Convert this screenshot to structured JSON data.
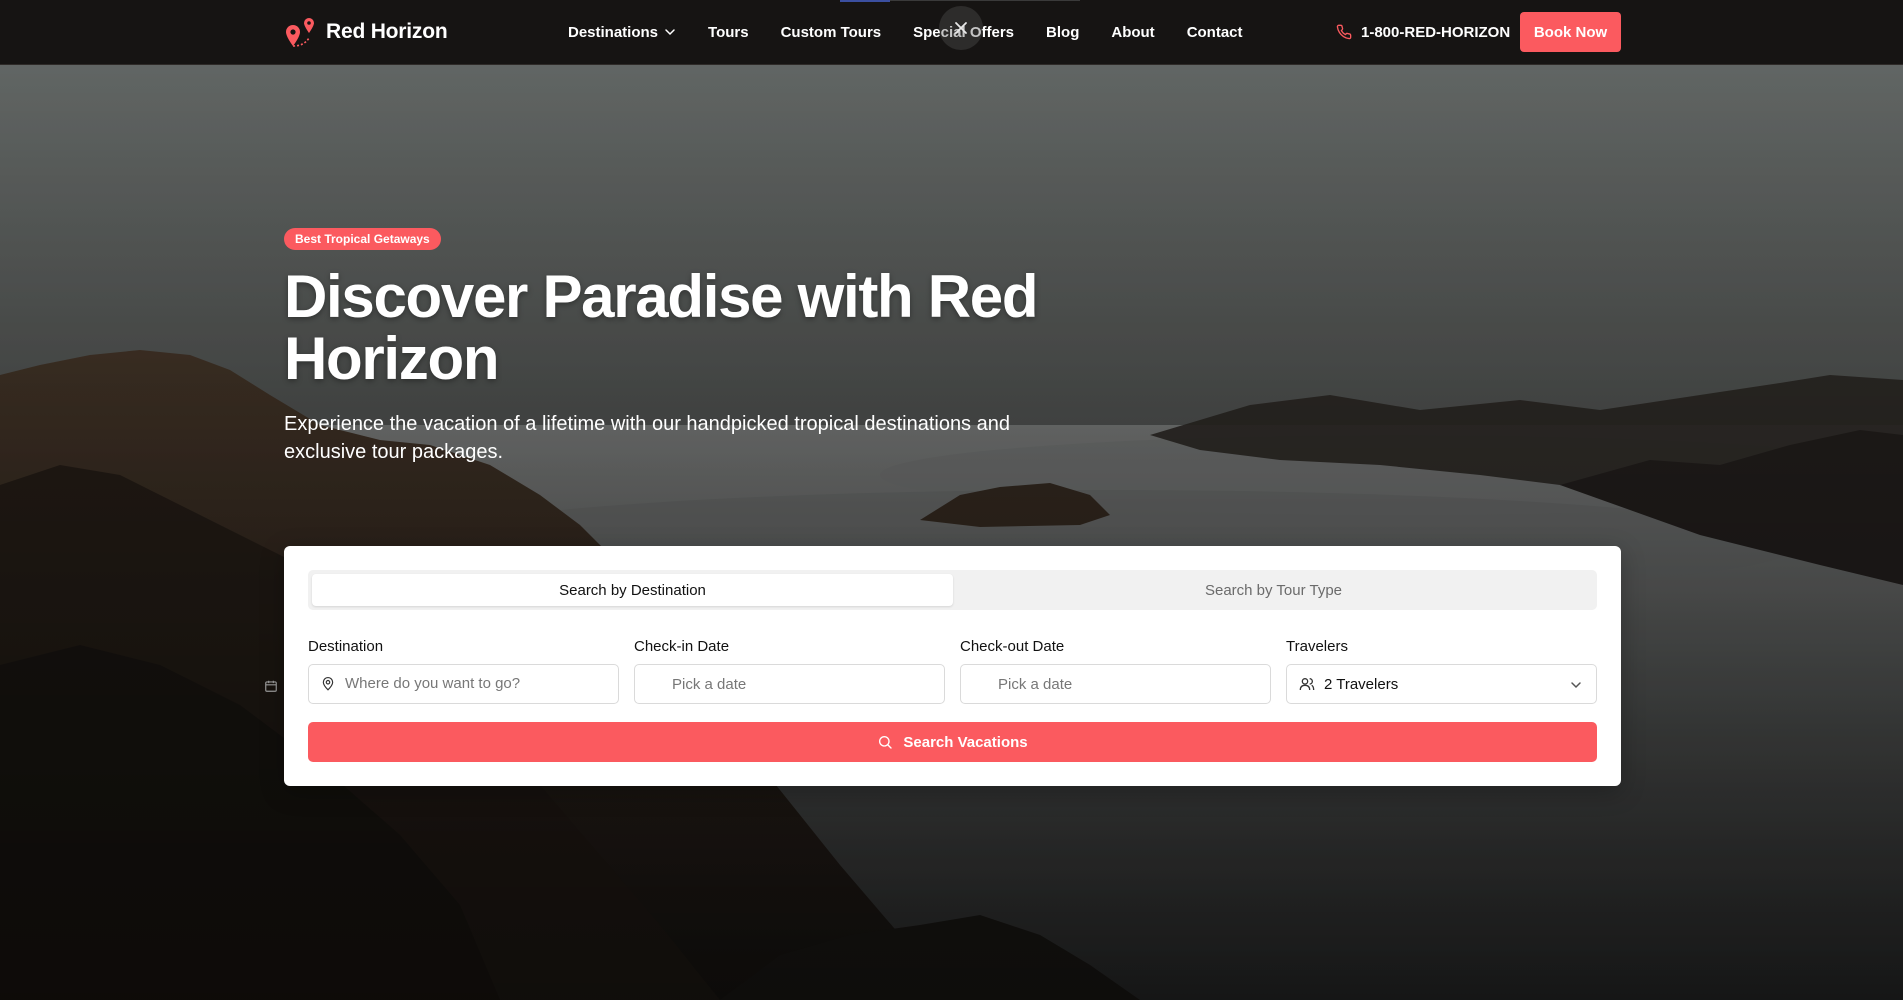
{
  "brand": {
    "name": "Red Horizon"
  },
  "nav": {
    "items": [
      {
        "label": "Destinations",
        "dropdown": true
      },
      {
        "label": "Tours"
      },
      {
        "label": "Custom Tours"
      },
      {
        "label": "Special Offers"
      },
      {
        "label": "Blog"
      },
      {
        "label": "About"
      },
      {
        "label": "Contact"
      }
    ]
  },
  "header": {
    "phone": "1-800-RED-HORIZON",
    "book_label": "Book Now"
  },
  "hero": {
    "badge": "Best Tropical Getaways",
    "title": "Discover Paradise with Red Horizon",
    "subtitle": "Experience the vacation of a lifetime with our handpicked tropical destinations and exclusive tour packages."
  },
  "search": {
    "tabs": [
      "Search by Destination",
      "Search by Tour Type"
    ],
    "active_tab": "Search by Destination",
    "destination": {
      "label": "Destination",
      "placeholder": "Where do you want to go?"
    },
    "checkin": {
      "label": "Check-in Date",
      "placeholder": "Pick a date"
    },
    "checkout": {
      "label": "Check-out Date",
      "placeholder": "Pick a date"
    },
    "travelers": {
      "label": "Travelers",
      "value": "2 Travelers"
    },
    "button_label": "Search Vacations"
  },
  "colors": {
    "accent": "#fb5a5f",
    "header_bg": "#161413"
  },
  "icons": [
    "map-pin-logo-icon",
    "chevron-down-icon",
    "close-icon",
    "phone-icon",
    "calendar-icon",
    "map-pin-icon",
    "users-icon",
    "search-icon"
  ]
}
